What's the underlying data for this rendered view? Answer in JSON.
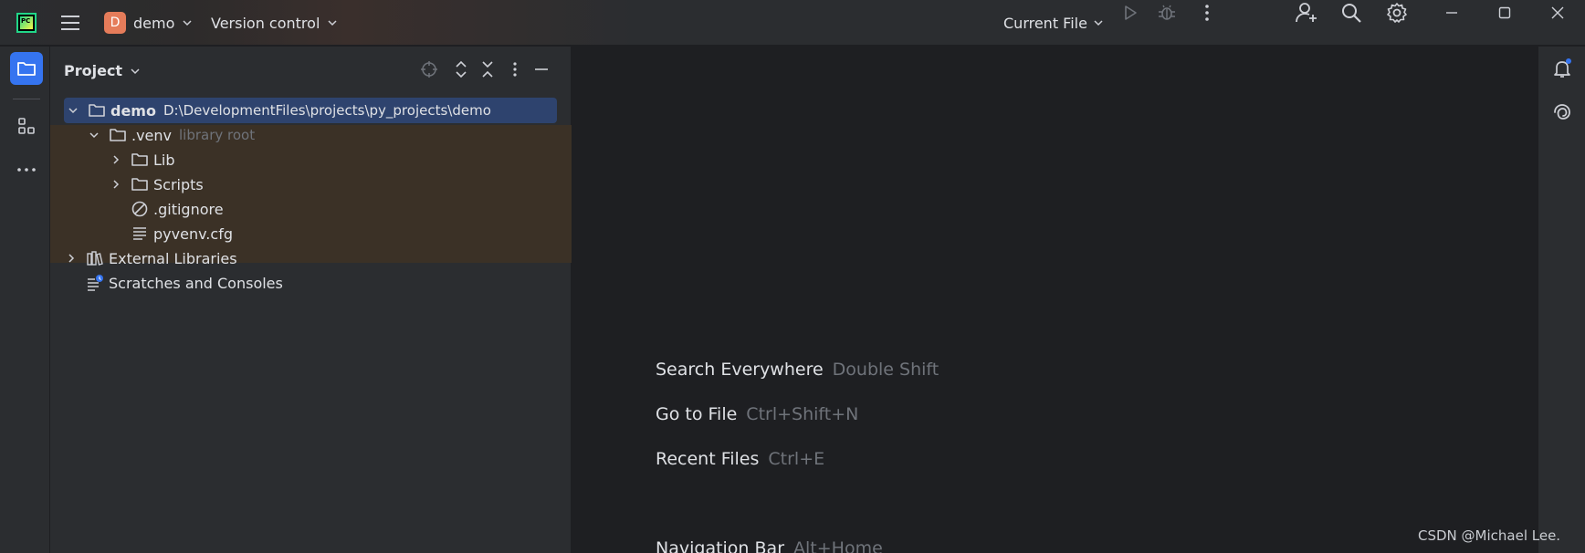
{
  "titlebar": {
    "project_badge": "D",
    "project_name": "demo",
    "vcs_label": "Version control",
    "run_config": "Current File"
  },
  "left_stripe": {
    "items": [
      {
        "icon": "folder-icon",
        "active": true
      },
      {
        "icon": "structure-icon",
        "active": false
      },
      {
        "icon": "more-horizontal-icon",
        "active": false
      }
    ]
  },
  "project_panel": {
    "title": "Project",
    "tree": [
      {
        "label": "demo",
        "detail": "D:\\DevelopmentFiles\\projects\\py_projects\\demo",
        "icon": "folder-icon",
        "expanded": true,
        "selected": true
      },
      {
        "label": ".venv",
        "detail": "library root",
        "icon": "folder-icon",
        "expanded": true
      },
      {
        "label": "Lib",
        "icon": "folder-icon",
        "expanded": false
      },
      {
        "label": "Scripts",
        "icon": "folder-icon",
        "expanded": false
      },
      {
        "label": ".gitignore",
        "icon": "ignore-file-icon"
      },
      {
        "label": "pyvenv.cfg",
        "icon": "text-file-icon"
      },
      {
        "label": "External Libraries",
        "icon": "library-icon",
        "expanded": false
      },
      {
        "label": "Scratches and Consoles",
        "icon": "scratches-icon"
      }
    ]
  },
  "editor": {
    "hints": [
      {
        "action": "Search Everywhere",
        "shortcut": "Double Shift"
      },
      {
        "action": "Go to File",
        "shortcut": "Ctrl+Shift+N"
      },
      {
        "action": "Recent Files",
        "shortcut": "Ctrl+E"
      },
      {
        "action": "Navigation Bar",
        "shortcut": "Alt+Home"
      }
    ]
  },
  "watermark": "CSDN @Michael Lee.",
  "colors": {
    "accent": "#3574f0",
    "selection": "#2e436e",
    "library_root_bg": "#3b3126",
    "project_badge": "#e57c5a"
  }
}
